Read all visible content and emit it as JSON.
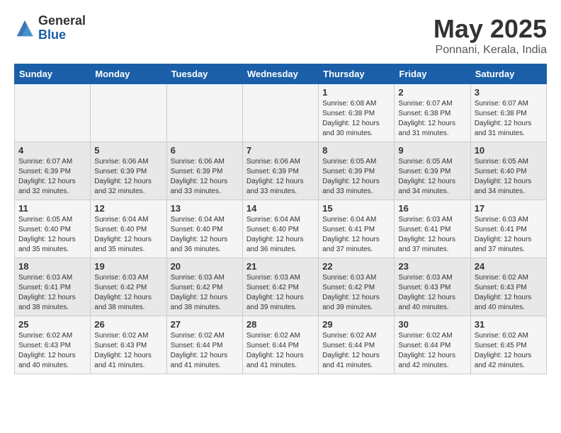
{
  "logo": {
    "general": "General",
    "blue": "Blue"
  },
  "title": "May 2025",
  "location": "Ponnani, Kerala, India",
  "days_of_week": [
    "Sunday",
    "Monday",
    "Tuesday",
    "Wednesday",
    "Thursday",
    "Friday",
    "Saturday"
  ],
  "weeks": [
    [
      {
        "day": "",
        "info": ""
      },
      {
        "day": "",
        "info": ""
      },
      {
        "day": "",
        "info": ""
      },
      {
        "day": "",
        "info": ""
      },
      {
        "day": "1",
        "info": "Sunrise: 6:08 AM\nSunset: 6:38 PM\nDaylight: 12 hours and 30 minutes."
      },
      {
        "day": "2",
        "info": "Sunrise: 6:07 AM\nSunset: 6:38 PM\nDaylight: 12 hours and 31 minutes."
      },
      {
        "day": "3",
        "info": "Sunrise: 6:07 AM\nSunset: 6:38 PM\nDaylight: 12 hours and 31 minutes."
      }
    ],
    [
      {
        "day": "4",
        "info": "Sunrise: 6:07 AM\nSunset: 6:39 PM\nDaylight: 12 hours and 32 minutes."
      },
      {
        "day": "5",
        "info": "Sunrise: 6:06 AM\nSunset: 6:39 PM\nDaylight: 12 hours and 32 minutes."
      },
      {
        "day": "6",
        "info": "Sunrise: 6:06 AM\nSunset: 6:39 PM\nDaylight: 12 hours and 33 minutes."
      },
      {
        "day": "7",
        "info": "Sunrise: 6:06 AM\nSunset: 6:39 PM\nDaylight: 12 hours and 33 minutes."
      },
      {
        "day": "8",
        "info": "Sunrise: 6:05 AM\nSunset: 6:39 PM\nDaylight: 12 hours and 33 minutes."
      },
      {
        "day": "9",
        "info": "Sunrise: 6:05 AM\nSunset: 6:39 PM\nDaylight: 12 hours and 34 minutes."
      },
      {
        "day": "10",
        "info": "Sunrise: 6:05 AM\nSunset: 6:40 PM\nDaylight: 12 hours and 34 minutes."
      }
    ],
    [
      {
        "day": "11",
        "info": "Sunrise: 6:05 AM\nSunset: 6:40 PM\nDaylight: 12 hours and 35 minutes."
      },
      {
        "day": "12",
        "info": "Sunrise: 6:04 AM\nSunset: 6:40 PM\nDaylight: 12 hours and 35 minutes."
      },
      {
        "day": "13",
        "info": "Sunrise: 6:04 AM\nSunset: 6:40 PM\nDaylight: 12 hours and 36 minutes."
      },
      {
        "day": "14",
        "info": "Sunrise: 6:04 AM\nSunset: 6:40 PM\nDaylight: 12 hours and 36 minutes."
      },
      {
        "day": "15",
        "info": "Sunrise: 6:04 AM\nSunset: 6:41 PM\nDaylight: 12 hours and 37 minutes."
      },
      {
        "day": "16",
        "info": "Sunrise: 6:03 AM\nSunset: 6:41 PM\nDaylight: 12 hours and 37 minutes."
      },
      {
        "day": "17",
        "info": "Sunrise: 6:03 AM\nSunset: 6:41 PM\nDaylight: 12 hours and 37 minutes."
      }
    ],
    [
      {
        "day": "18",
        "info": "Sunrise: 6:03 AM\nSunset: 6:41 PM\nDaylight: 12 hours and 38 minutes."
      },
      {
        "day": "19",
        "info": "Sunrise: 6:03 AM\nSunset: 6:42 PM\nDaylight: 12 hours and 38 minutes."
      },
      {
        "day": "20",
        "info": "Sunrise: 6:03 AM\nSunset: 6:42 PM\nDaylight: 12 hours and 38 minutes."
      },
      {
        "day": "21",
        "info": "Sunrise: 6:03 AM\nSunset: 6:42 PM\nDaylight: 12 hours and 39 minutes."
      },
      {
        "day": "22",
        "info": "Sunrise: 6:03 AM\nSunset: 6:42 PM\nDaylight: 12 hours and 39 minutes."
      },
      {
        "day": "23",
        "info": "Sunrise: 6:03 AM\nSunset: 6:43 PM\nDaylight: 12 hours and 40 minutes."
      },
      {
        "day": "24",
        "info": "Sunrise: 6:02 AM\nSunset: 6:43 PM\nDaylight: 12 hours and 40 minutes."
      }
    ],
    [
      {
        "day": "25",
        "info": "Sunrise: 6:02 AM\nSunset: 6:43 PM\nDaylight: 12 hours and 40 minutes."
      },
      {
        "day": "26",
        "info": "Sunrise: 6:02 AM\nSunset: 6:43 PM\nDaylight: 12 hours and 41 minutes."
      },
      {
        "day": "27",
        "info": "Sunrise: 6:02 AM\nSunset: 6:44 PM\nDaylight: 12 hours and 41 minutes."
      },
      {
        "day": "28",
        "info": "Sunrise: 6:02 AM\nSunset: 6:44 PM\nDaylight: 12 hours and 41 minutes."
      },
      {
        "day": "29",
        "info": "Sunrise: 6:02 AM\nSunset: 6:44 PM\nDaylight: 12 hours and 41 minutes."
      },
      {
        "day": "30",
        "info": "Sunrise: 6:02 AM\nSunset: 6:44 PM\nDaylight: 12 hours and 42 minutes."
      },
      {
        "day": "31",
        "info": "Sunrise: 6:02 AM\nSunset: 6:45 PM\nDaylight: 12 hours and 42 minutes."
      }
    ]
  ]
}
